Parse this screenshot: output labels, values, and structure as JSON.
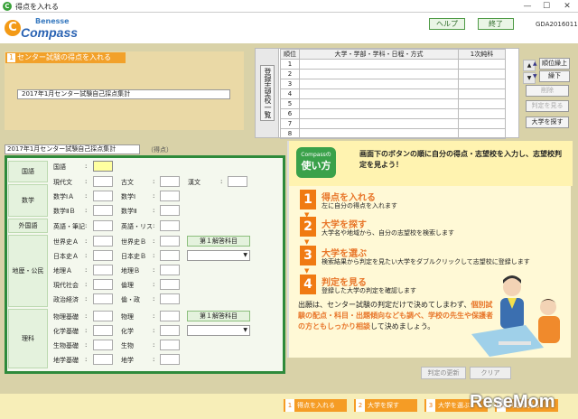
{
  "window": {
    "title": "得点を入れる",
    "app_icon": "C",
    "minimize": "—",
    "maximize": "☐",
    "close": "✕"
  },
  "header": {
    "logo_small": "Benesse",
    "logo_letter": "C",
    "logo_main": "Compass",
    "help": "ヘルプ",
    "exit": "終了",
    "code": "GDA2016011"
  },
  "score_entry": {
    "num": "1",
    "title": "センター試験の得点を入れる",
    "selected_exam": "2017年1月センター試験自己採点集計"
  },
  "wishlist": {
    "vertical_button": "登録志望校一覧",
    "columns": [
      "順位",
      "大学・学部・学科・日程・方式",
      "1次純科"
    ],
    "rows": [
      "1",
      "2",
      "3",
      "4",
      "5",
      "6",
      "7",
      "8"
    ]
  },
  "right_buttons": {
    "rank_up": "順位繰上",
    "rank_down": "繰下",
    "delete": "削除",
    "view_judgement": "判定を見る",
    "search_univ": "大学を探す"
  },
  "scores": {
    "exam_label": "2017年1月センター試験自己採点集計",
    "points_label": "（得点）",
    "cat_kokugo": "国語",
    "kokugo": "国語",
    "cat_suugaku": "数学",
    "cat_gaikokugo": "外国語",
    "cat_chireki": "地歴・公民",
    "cat_rika": "理科",
    "gendaibun": "現代文",
    "kobun": "古文",
    "kanbun": "漢文",
    "math1a": "数学ⅠＡ",
    "math1": "数学Ⅰ",
    "math2b": "数学ⅡＢ",
    "math2": "数学Ⅱ",
    "eng_written": "英語・筆記",
    "eng_listen": "英語・リス",
    "sekaishi_a": "世界史Ａ",
    "sekaishi_b": "世界史Ｂ",
    "nihonshi_a": "日本史Ａ",
    "nihonshi_b": "日本史Ｂ",
    "chiri_a": "地理Ａ",
    "chiri_b": "地理Ｂ",
    "gendai_shakai": "現代社会",
    "rinri": "倫理",
    "seiji_keizai": "政治経済",
    "rinri_seikei": "倫・政",
    "butsuri_kiso": "物理基礎",
    "butsuri": "物理",
    "kagaku_kiso": "化学基礎",
    "kagaku": "化学",
    "seibutsu_kiso": "生物基礎",
    "seibutsu": "生物",
    "chigaku_kiso": "地学基礎",
    "chigaku": "地学",
    "first_answer_1": "第１解答科目",
    "first_answer_2": "第１解答科目",
    "colon": ":"
  },
  "howto": {
    "badge_small": "Compassの",
    "badge_big": "使い方",
    "headline": "画面下のボタンの順に自分の得点・志望校を入力し、志望校判定を見よう！",
    "steps": [
      {
        "n": "1",
        "title": "得点を入れる",
        "desc": "左に自分の得点を入れます"
      },
      {
        "n": "2",
        "title": "大学を探す",
        "desc": "大学名や地域から、自分の志望校を検索します"
      },
      {
        "n": "3",
        "title": "大学を選ぶ",
        "desc": "検索結果から判定を見たい大学をダブルクリックして志望校に登録します"
      },
      {
        "n": "4",
        "title": "判定を見る",
        "desc": "登録した大学の判定を確認します"
      }
    ],
    "note_a": "出願は、センター試験の判定だけで決めてしまわず、",
    "note_hl": "個別試験の配点・科目・出題傾向なども調べ、学校の先生や保護者の方ともしっかり相談",
    "note_b": "して決めましょう。"
  },
  "bottom": {
    "update": "判定の更新",
    "clear": "クリア"
  },
  "footer_steps": [
    {
      "n": "1",
      "label": "得点を入れる"
    },
    {
      "n": "2",
      "label": "大学を探す"
    },
    {
      "n": "3",
      "label": "大学を選ぶ"
    },
    {
      "n": "4",
      "label": "判定を見る"
    }
  ],
  "watermark": "ReseMom",
  "colors": {
    "green": "#2e8a3b",
    "orange": "#f2a12a",
    "tan": "#ead9a6"
  }
}
